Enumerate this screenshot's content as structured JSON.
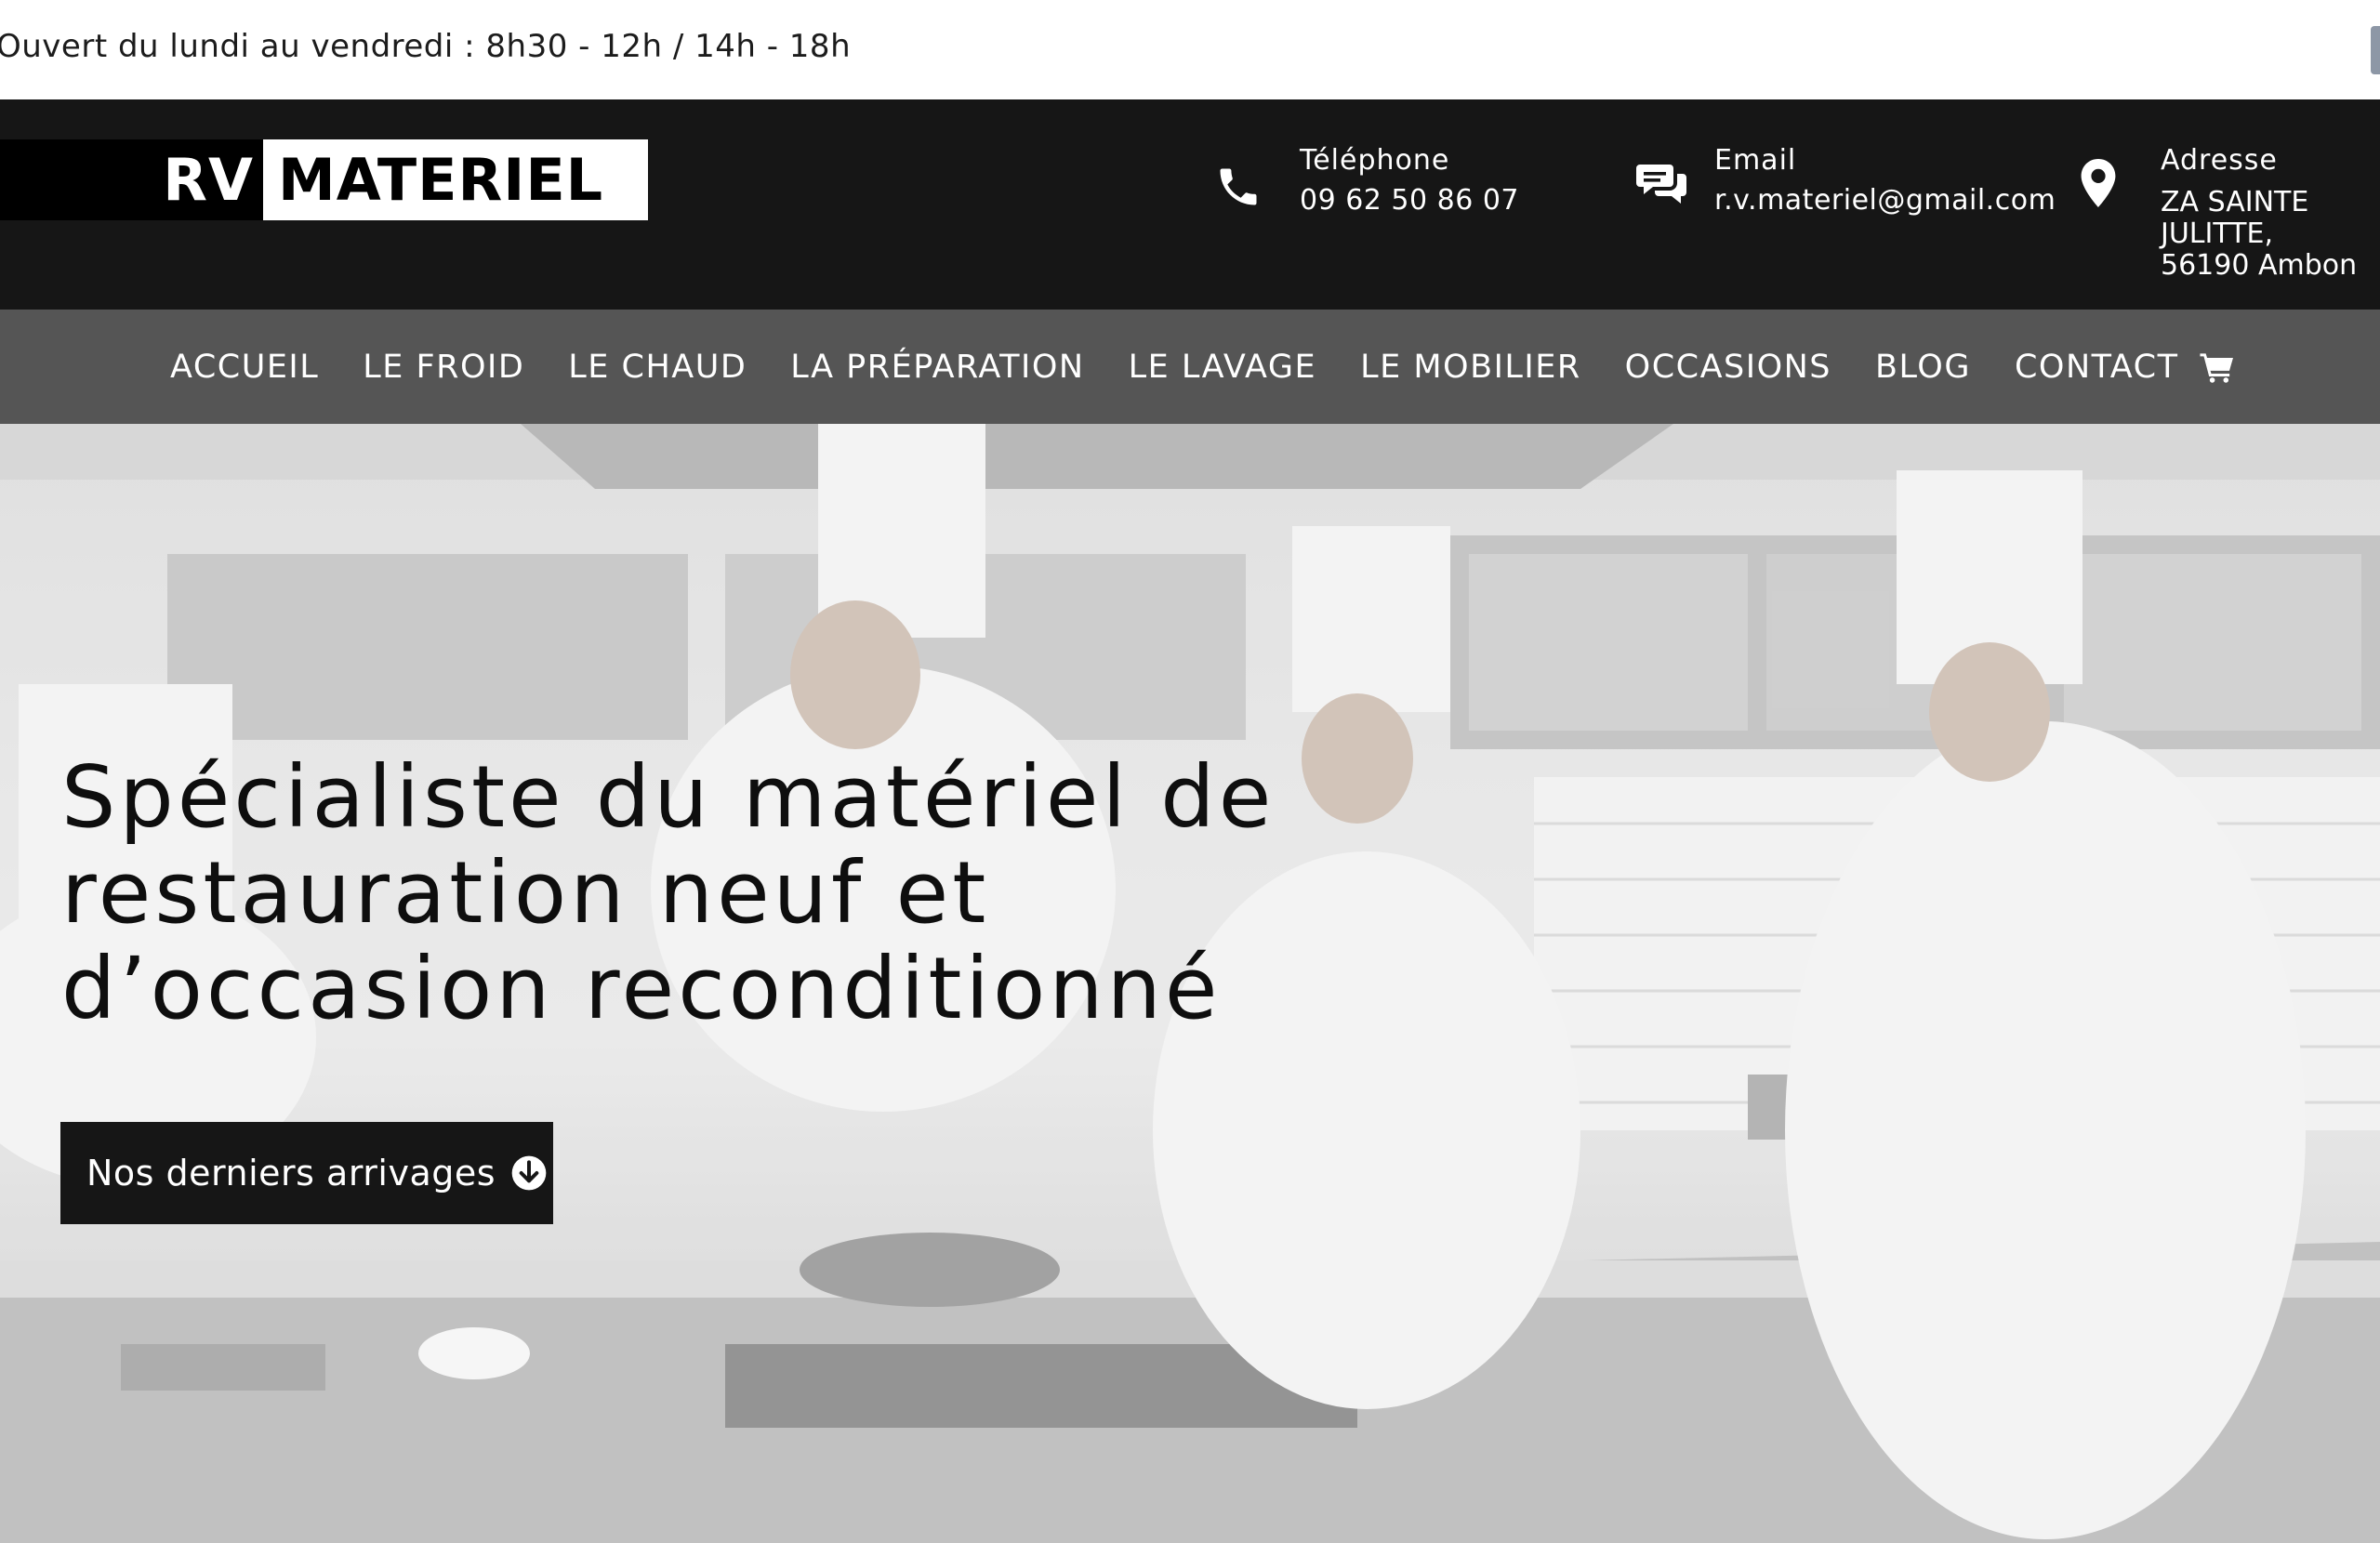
{
  "topbar": {
    "hours": "Ouvert du lundi au vendredi : 8h30 - 12h / 14h - 18h"
  },
  "header": {
    "logo": {
      "part1": "RV",
      "part2": "MATERIEL"
    },
    "phone": {
      "icon": "phone-icon",
      "label": "Téléphone",
      "value": "09 62 50 86 07"
    },
    "email": {
      "icon": "chat-bubbles-icon",
      "label": "Email",
      "value": "r.v.materiel@gmail.com"
    },
    "address": {
      "icon": "map-pin-icon",
      "label": "Adresse",
      "lines": [
        "ZA SAINTE",
        "JULITTE,",
        "56190 Ambon"
      ]
    }
  },
  "nav": {
    "items": [
      {
        "label": "ACCUEIL"
      },
      {
        "label": "LE FROID"
      },
      {
        "label": "LE CHAUD"
      },
      {
        "label": "LA PRÉPARATION"
      },
      {
        "label": "LE LAVAGE"
      },
      {
        "label": "LE MOBILIER"
      },
      {
        "label": "OCCASIONS"
      },
      {
        "label": "BLOG"
      },
      {
        "label": "CONTACT"
      }
    ],
    "cart_icon": "cart-icon"
  },
  "hero": {
    "title_lines": [
      "Spécialiste du matériel de",
      "restauration neuf et",
      "d’occasion reconditionné"
    ],
    "cta_label": "Nos derniers arrivages",
    "cta_icon": "arrow-down-circle-icon"
  },
  "colors": {
    "header_bg": "#161616",
    "nav_bg": "#555555",
    "cta_bg": "#161616",
    "text_dark": "#0e0e0e"
  }
}
